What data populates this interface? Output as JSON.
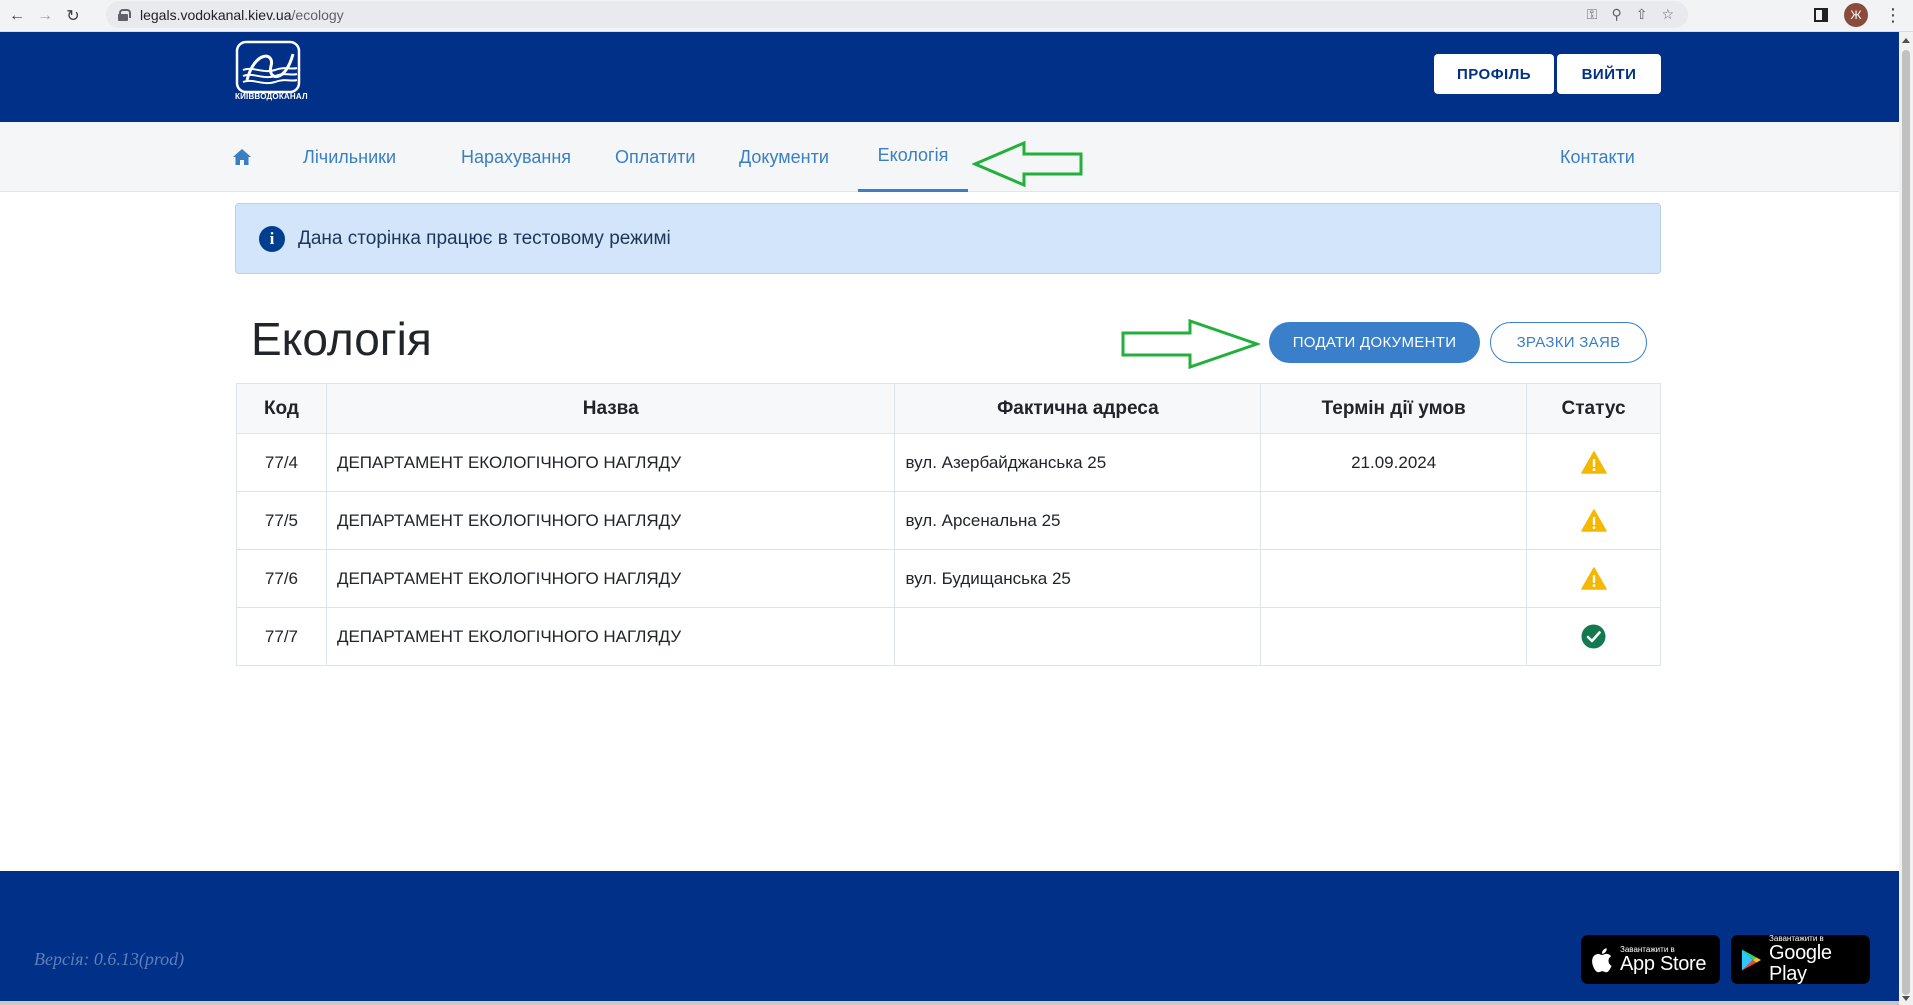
{
  "browser": {
    "url_host": "legals.vodokanal.kiev.ua",
    "url_path": "/ecology",
    "avatar_letter": "Ж"
  },
  "header": {
    "logo_text": "КИЇВВОДОКАНАЛ",
    "profile_label": "ПРОФІЛЬ",
    "logout_label": "ВИЙТИ"
  },
  "nav": {
    "items": [
      {
        "label": "Лічильники"
      },
      {
        "label": "Нарахування"
      },
      {
        "label": "Оплатити"
      },
      {
        "label": "Документи"
      },
      {
        "label": "Екологія",
        "active": true
      }
    ],
    "contacts_label": "Контакти"
  },
  "alert": {
    "text": "Дана сторінка працює в тестовому режимі"
  },
  "main": {
    "title": "Екологія",
    "submit_label": "ПОДАТИ ДОКУМЕНТИ",
    "samples_label": "ЗРАЗКИ ЗАЯВ"
  },
  "table": {
    "columns": [
      "Код",
      "Назва",
      "Фактична адреса",
      "Термін дії умов",
      "Статус"
    ],
    "rows": [
      {
        "code": "77/4",
        "name": "ДЕПАРТАМЕНТ ЕКОЛОГІЧНОГО НАГЛЯДУ",
        "address": "вул. Азербайджанська 25",
        "term": "21.09.2024",
        "status": "warning-icon"
      },
      {
        "code": "77/5",
        "name": "ДЕПАРТАМЕНТ ЕКОЛОГІЧНОГО НАГЛЯДУ",
        "address": "вул. Арсенальна 25",
        "term": "",
        "status": "warning-icon"
      },
      {
        "code": "77/6",
        "name": "ДЕПАРТАМЕНТ ЕКОЛОГІЧНОГО НАГЛЯДУ",
        "address": "вул. Будищанська 25",
        "term": "",
        "status": "warning-icon"
      },
      {
        "code": "77/7",
        "name": "ДЕПАРТАМЕНТ ЕКОЛОГІЧНОГО НАГЛЯДУ",
        "address": "",
        "term": "",
        "status": "check-circle-icon"
      }
    ]
  },
  "footer": {
    "version": "Версія: 0.6.13(prod)",
    "app_store_small": "Завантажити в",
    "app_store_big": "App Store",
    "google_play_small": "Завантажити в",
    "google_play_big": "Google Play"
  },
  "colors": {
    "brand_blue": "#003087",
    "accent_blue": "#3a7fc9",
    "warning": "#f5b800",
    "success": "#137a4f",
    "annotation_arrow": "#22b03a"
  }
}
